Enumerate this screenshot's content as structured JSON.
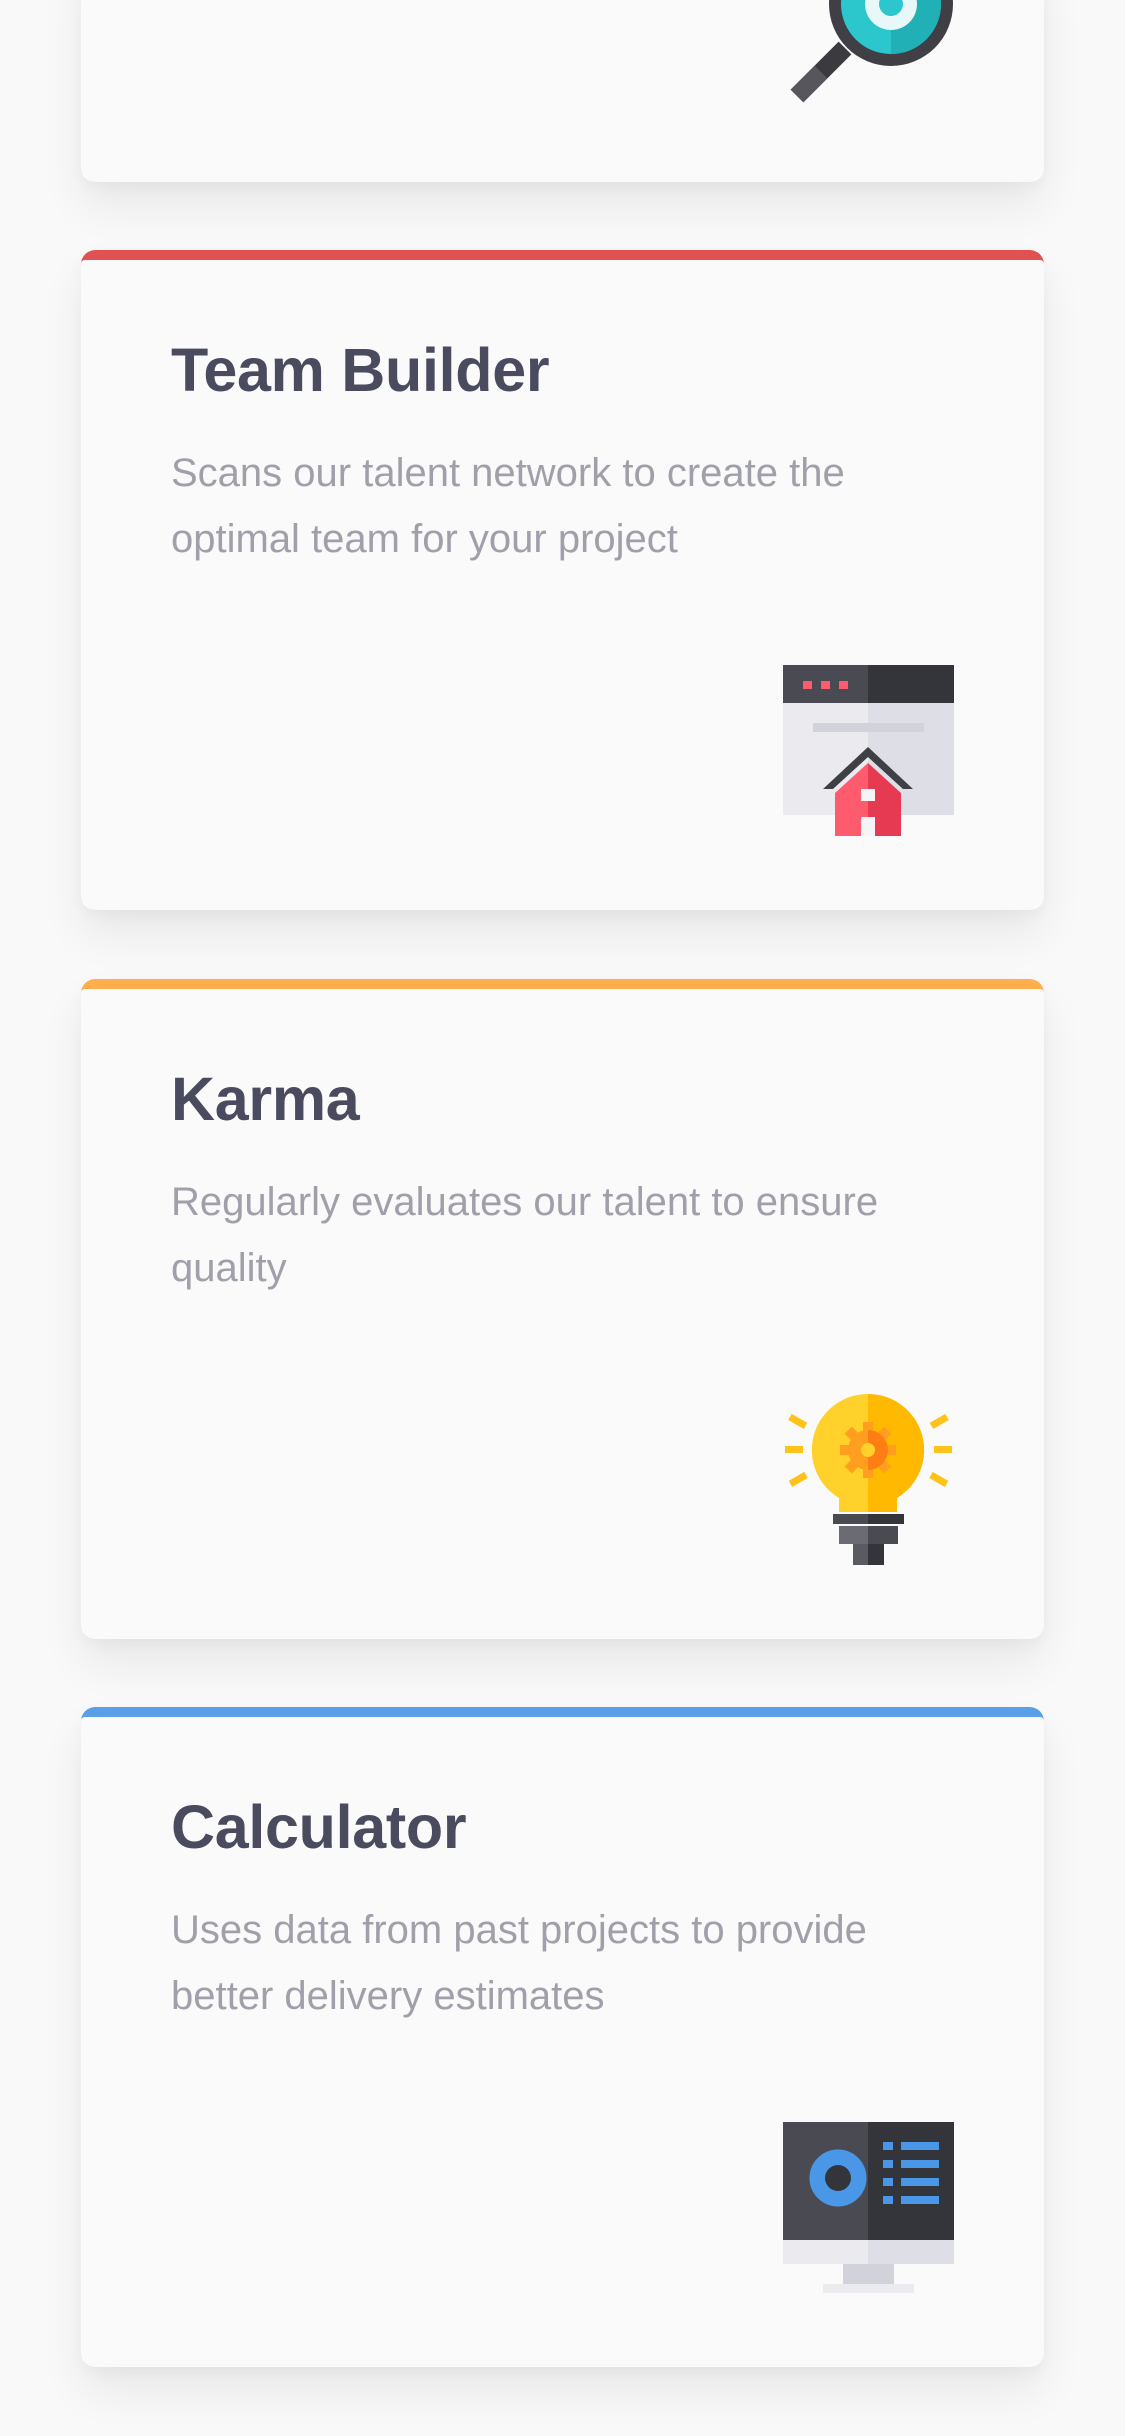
{
  "cards": [
    {
      "id": "top",
      "title": "",
      "description": "",
      "icon": "magnifier-icon"
    },
    {
      "id": "team-builder",
      "title": "Team Builder",
      "description": "Scans our talent network to create the optimal team for your project",
      "accent_color": "#e05252",
      "icon": "website-home-icon"
    },
    {
      "id": "karma",
      "title": "Karma",
      "description": "Regularly evaluates our talent to ensure quality",
      "accent_color": "#ffad4d",
      "icon": "lightbulb-icon"
    },
    {
      "id": "calculator",
      "title": "Calculator",
      "description": "Uses data from past projects to provide better delivery estimates",
      "accent_color": "#5aa0e6",
      "icon": "monitor-chart-icon"
    }
  ],
  "colors": {
    "background": "#f9f9f9",
    "card": "#fafafa",
    "title": "#4a4b5e",
    "description": "#a0a0aa"
  }
}
